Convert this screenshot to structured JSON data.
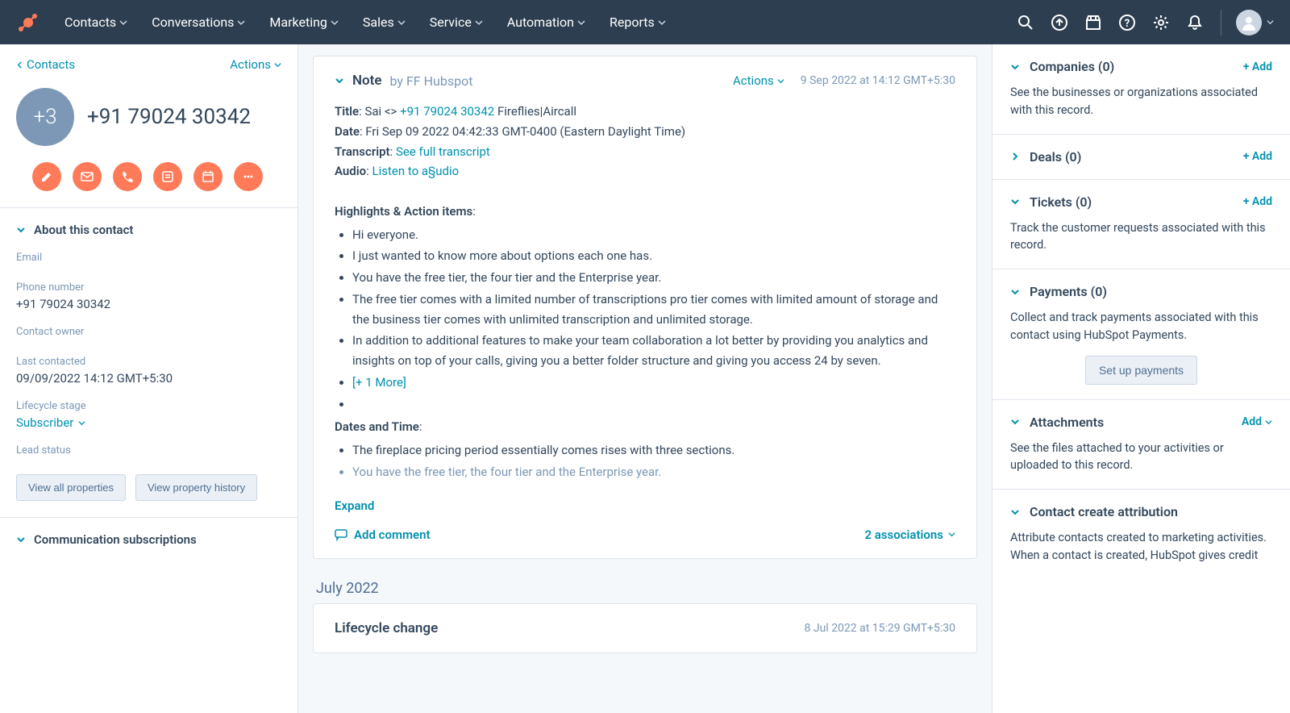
{
  "nav": {
    "items": [
      "Contacts",
      "Conversations",
      "Marketing",
      "Sales",
      "Service",
      "Automation",
      "Reports"
    ]
  },
  "left": {
    "back": "Contacts",
    "actions": "Actions",
    "avatar_badge": "+3",
    "name": "+91 79024 30342",
    "about_header": "About this contact",
    "fields": {
      "email_label": "Email",
      "email_value": "",
      "phone_label": "Phone number",
      "phone_value": "+91 79024 30342",
      "owner_label": "Contact owner",
      "owner_value": "",
      "last_contacted_label": "Last contacted",
      "last_contacted_value": "09/09/2022 14:12 GMT+5:30",
      "lifecycle_label": "Lifecycle stage",
      "lifecycle_value": "Subscriber",
      "lead_status_label": "Lead status",
      "lead_status_value": ""
    },
    "view_all": "View all properties",
    "view_history": "View property history",
    "comm_header": "Communication subscriptions"
  },
  "note": {
    "label": "Note",
    "by_prefix": "by",
    "author": "FF Hubspot",
    "actions": "Actions",
    "date": "9 Sep 2022 at 14:12 GMT+5:30",
    "title_label": "Title",
    "title_prefix": "Sai <> ",
    "title_link": "+91 79024 30342",
    "title_suffix": " Fireflies|Aircall",
    "date_label": "Date",
    "date_value": "Fri Sep 09 2022 04:42:33 GMT-0400 (Eastern Daylight Time)",
    "transcript_label": "Transcript",
    "transcript_link": "See full transcript",
    "audio_label": "Audio",
    "audio_link": "Listen to a§udio",
    "highlights_label": "Highlights & Action items",
    "bullets": [
      "Hi everyone.",
      "I just wanted to know more about options each one has.",
      "You have the free tier, the four tier and the Enterprise year.",
      "The free tier comes with a limited number of transcriptions pro tier comes with limited amount of storage and the business tier comes with unlimited transcription and unlimited storage.",
      "In addition to additional features to make your team collaboration a lot better by providing you analytics and insights on top of your calls, giving you a better folder structure and giving you access 24 by seven."
    ],
    "more_link": "[+ 1 More]",
    "dates_label": "Dates and Time",
    "dates_bullets": [
      "The fireplace pricing period essentially comes rises with three sections.",
      "You have the free tier, the four tier and the Enterprise year."
    ],
    "expand": "Expand",
    "add_comment": "Add comment",
    "associations": "2 associations"
  },
  "timeline": {
    "month": "July 2022",
    "lifecycle_title": "Lifecycle change",
    "lifecycle_date": "8 Jul 2022 at 15:29 GMT+5:30"
  },
  "right": {
    "companies": {
      "title": "Companies (0)",
      "add": "+ Add",
      "desc": "See the businesses or organizations associated with this record."
    },
    "deals": {
      "title": "Deals (0)",
      "add": "+ Add"
    },
    "tickets": {
      "title": "Tickets (0)",
      "add": "+ Add",
      "desc": "Track the customer requests associated with this record."
    },
    "payments": {
      "title": "Payments (0)",
      "desc": "Collect and track payments associated with this contact using HubSpot Payments.",
      "button": "Set up payments"
    },
    "attachments": {
      "title": "Attachments",
      "add": "Add",
      "desc": "See the files attached to your activities or uploaded to this record."
    },
    "attribution": {
      "title": "Contact create attribution",
      "desc": "Attribute contacts created to marketing activities. When a contact is created, HubSpot gives credit"
    }
  }
}
